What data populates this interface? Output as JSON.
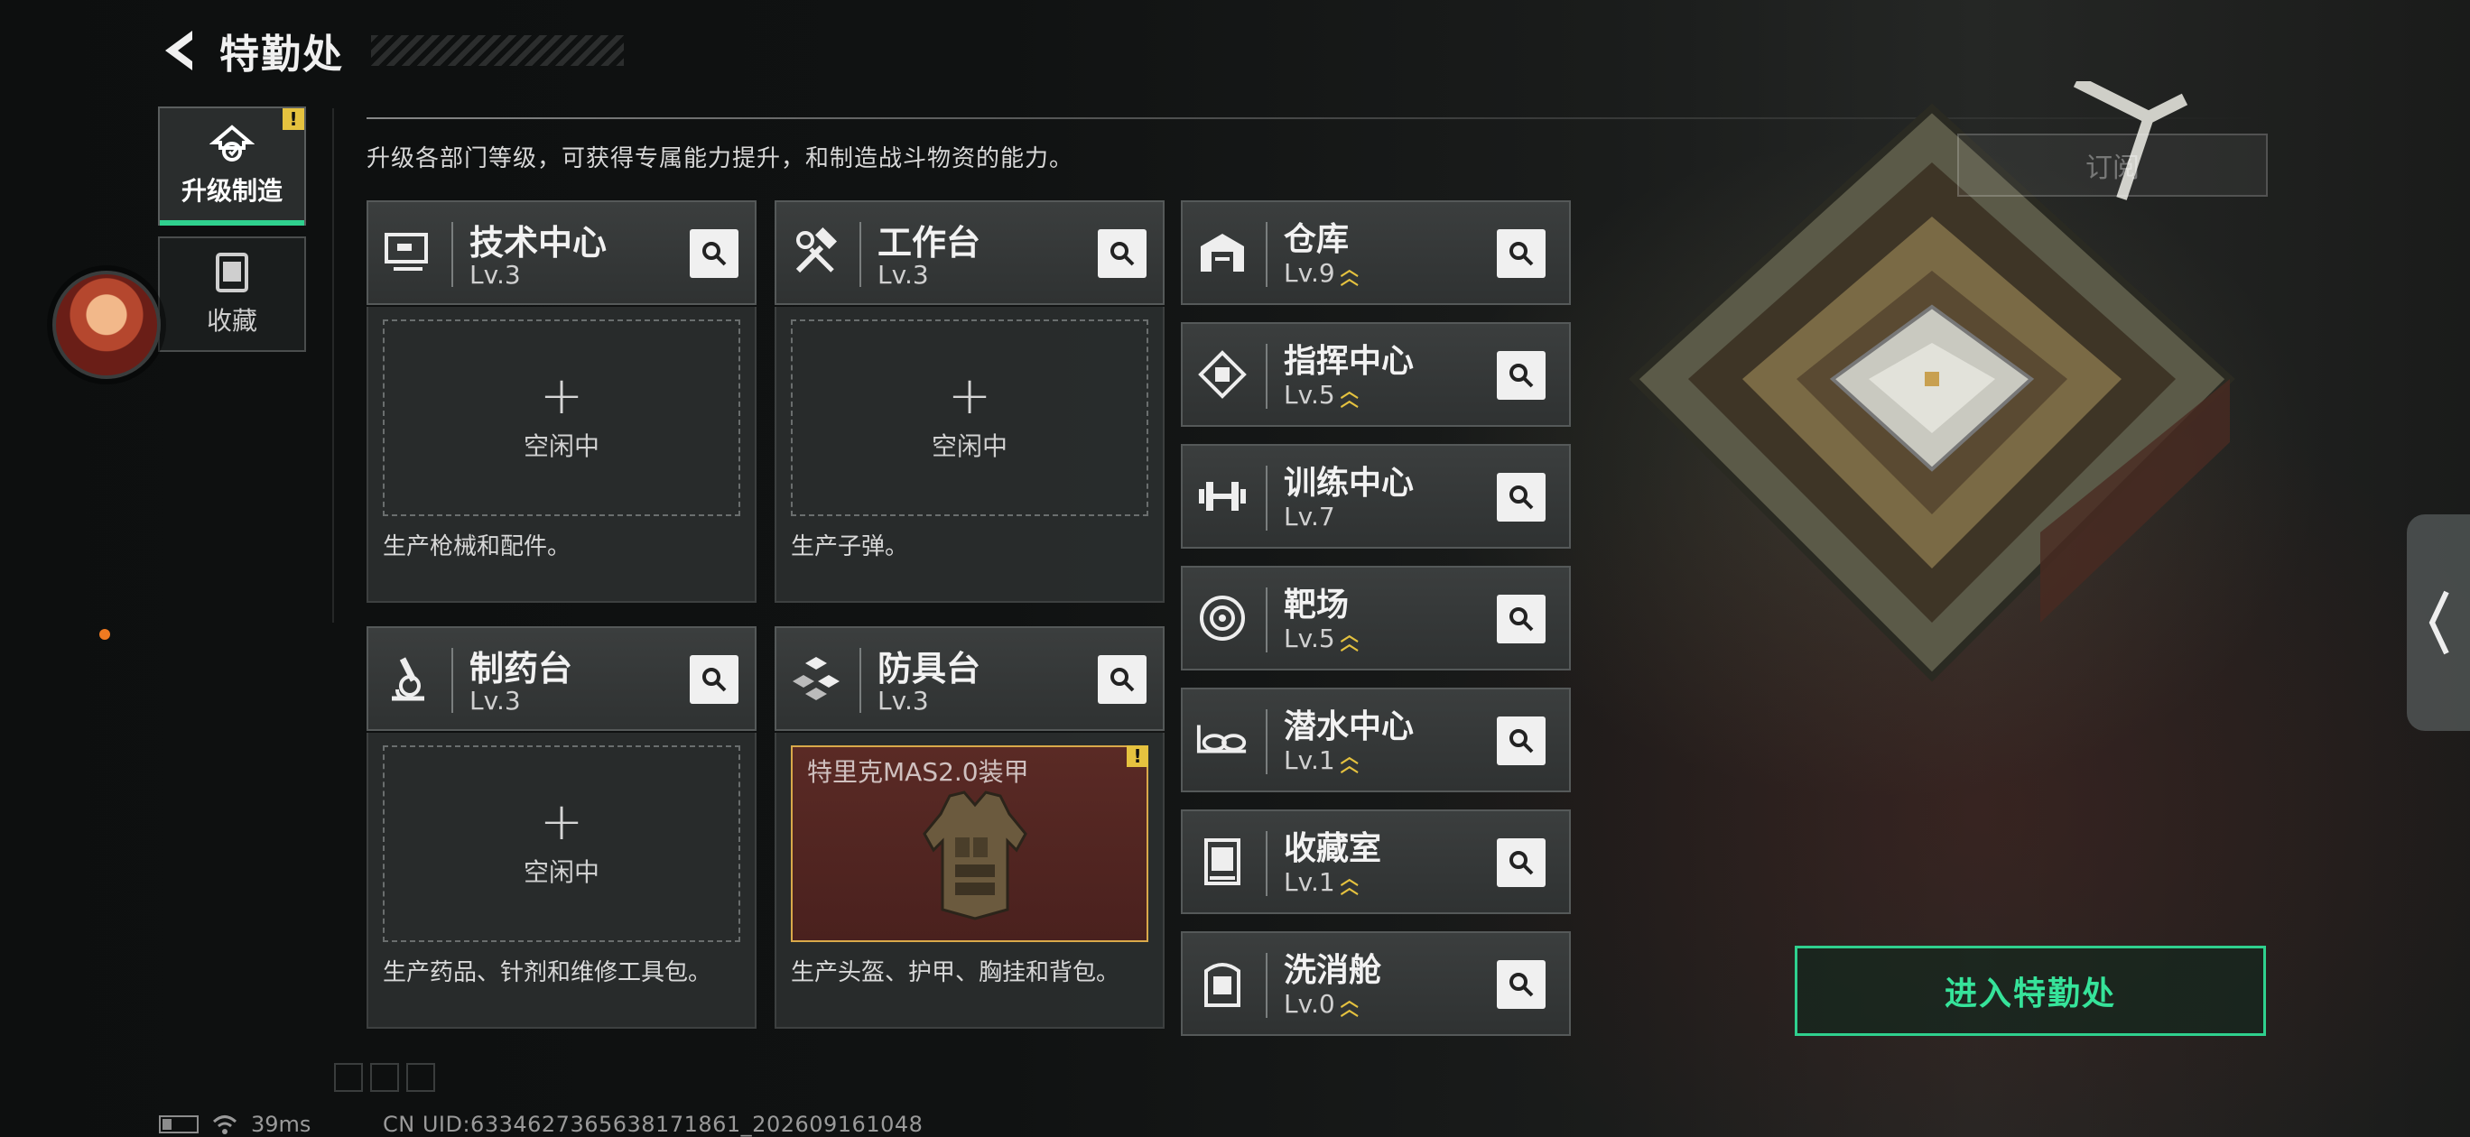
{
  "header": {
    "title": "特勤处"
  },
  "rail": {
    "items": [
      {
        "label": "升级制造",
        "active": true,
        "badge": "!"
      },
      {
        "label": "收藏",
        "active": false
      }
    ]
  },
  "subtitle": "升级各部门等级，可获得专属能力提升，和制造战斗物资的能力。",
  "subscribe_label": "订阅",
  "workshops": [
    {
      "name": "技术中心",
      "level": "Lv.3",
      "icon": "monitor-icon",
      "slot": "空闲中",
      "desc": "生产枪械和配件。"
    },
    {
      "name": "工作台",
      "level": "Lv.3",
      "icon": "hammer-wrench-icon",
      "slot": "空闲中",
      "desc": "生产子弹。"
    },
    {
      "name": "制药台",
      "level": "Lv.3",
      "icon": "microscope-icon",
      "slot": "空闲中",
      "desc": "生产药品、针剂和维修工具包。"
    },
    {
      "name": "防具台",
      "level": "Lv.3",
      "icon": "armor-blocks-icon",
      "item": "特里克MAS2.0装甲",
      "item_badge": "!",
      "desc": "生产头盔、护甲、胸挂和背包。"
    }
  ],
  "facilities": [
    {
      "name": "仓库",
      "level": "Lv.9",
      "upgradable": true,
      "icon": "warehouse-icon"
    },
    {
      "name": "指挥中心",
      "level": "Lv.5",
      "upgradable": true,
      "icon": "command-icon"
    },
    {
      "name": "训练中心",
      "level": "Lv.7",
      "upgradable": false,
      "icon": "dumbbell-icon"
    },
    {
      "name": "靶场",
      "level": "Lv.5",
      "upgradable": true,
      "icon": "target-icon"
    },
    {
      "name": "潜水中心",
      "level": "Lv.1",
      "upgradable": true,
      "icon": "diving-mask-icon"
    },
    {
      "name": "收藏室",
      "level": "Lv.1",
      "upgradable": true,
      "icon": "collection-case-icon"
    },
    {
      "name": "洗消舱",
      "level": "Lv.0",
      "upgradable": true,
      "icon": "decon-pod-icon"
    }
  ],
  "enter_label": "进入特勤处",
  "status": {
    "ping": "39ms",
    "uid": "CN UID:6334627365638171861_202609161048"
  },
  "colors": {
    "accent": "#2fd08e",
    "warning": "#e5c23f"
  }
}
